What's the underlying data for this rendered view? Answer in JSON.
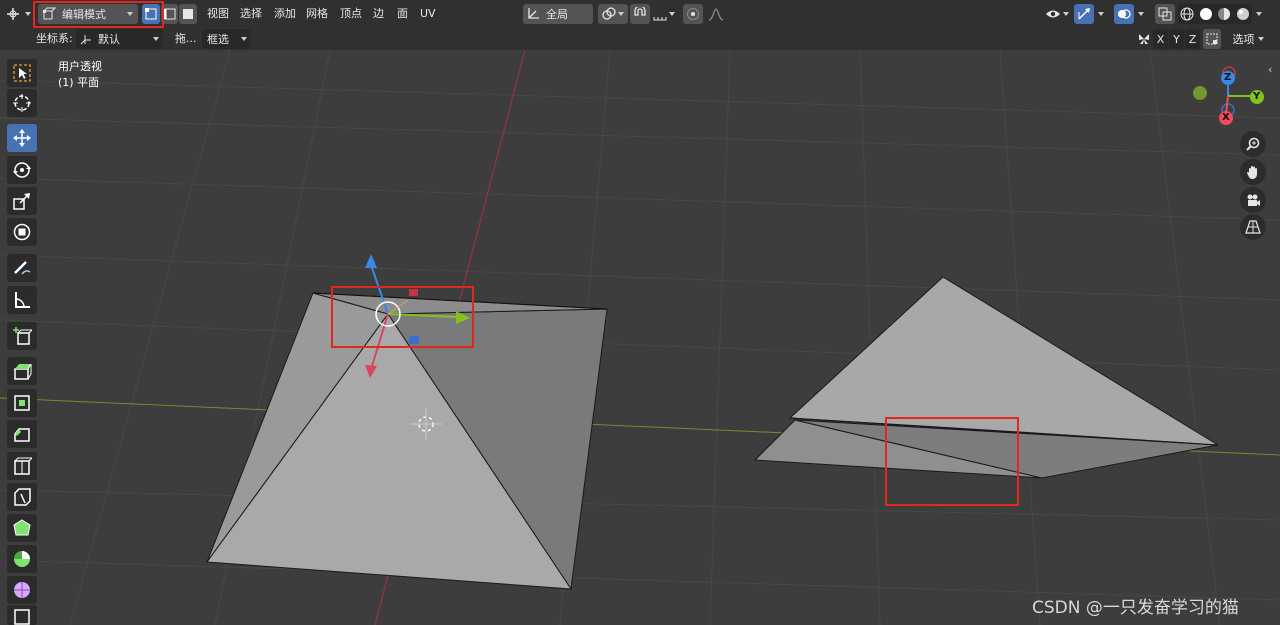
{
  "header": {
    "mode": "编辑模式",
    "menus": [
      "视图",
      "选择",
      "添加",
      "网格",
      "顶点",
      "边",
      "面",
      "UV"
    ],
    "pivot_label": "全局"
  },
  "toolbar2": {
    "orientation_label": "坐标系:",
    "orientation_value": "默认",
    "drag_label": "拖...",
    "select_mode": "框选",
    "mirror_axes": [
      "X",
      "Y",
      "Z"
    ],
    "options_label": "选项"
  },
  "viewport": {
    "view_name": "用户透视",
    "object_name": "(1) 平面"
  },
  "gizmo": {
    "axes": [
      "Z",
      "Y",
      "X"
    ],
    "colors": {
      "x": "#f04b5a",
      "y": "#84c21b",
      "z": "#3b87e8"
    }
  },
  "watermark": "CSDN @一只发奋学习的猫",
  "colors": {
    "accent": "#4772b3",
    "highlight": "#e1281e",
    "viewport_bg": "#3d3d3d",
    "header_bg": "#303030"
  }
}
